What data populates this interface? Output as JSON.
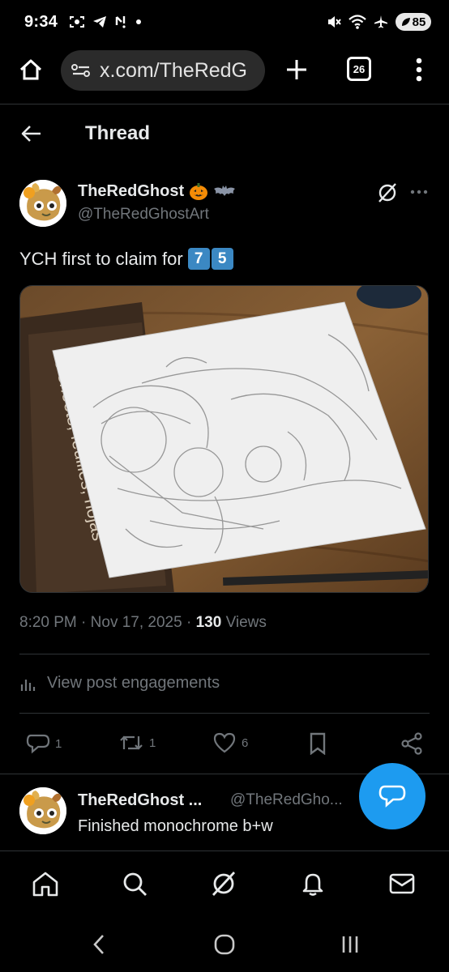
{
  "status_bar": {
    "time": "9:34",
    "battery": "85"
  },
  "browser": {
    "url": "x.com/TheRedG",
    "tab_count": "26"
  },
  "header": {
    "title": "Thread"
  },
  "post": {
    "author_name": "TheRedGhost",
    "author_emojis": [
      "jack-o-lantern-icon",
      "bat-icon"
    ],
    "handle": "@TheRedGhostArt",
    "text": "YCH first to claim for",
    "keycap_digits": [
      "7",
      "5"
    ],
    "image_description_icon": "pencil-sketch-photo",
    "time": "8:20 PM",
    "date": "Nov 17, 2025",
    "views_count": "130",
    "views_label": "Views",
    "sketchbook_label": "15 sheets, feuilles, hojas",
    "view_engagements_label": "View post engagements",
    "actions": {
      "replies": "1",
      "reposts": "1",
      "likes": "6"
    }
  },
  "reply": {
    "author_name": "TheRedGhost ...",
    "handle": "@TheRedGho...",
    "text": "Finished monochrome b+w"
  },
  "colors": {
    "background": "#000000",
    "text_primary": "#e7e9ea",
    "text_secondary": "#71767b",
    "accent": "#1d9bf0",
    "divider": "#2f3336",
    "keycap": "#3b88c3"
  }
}
